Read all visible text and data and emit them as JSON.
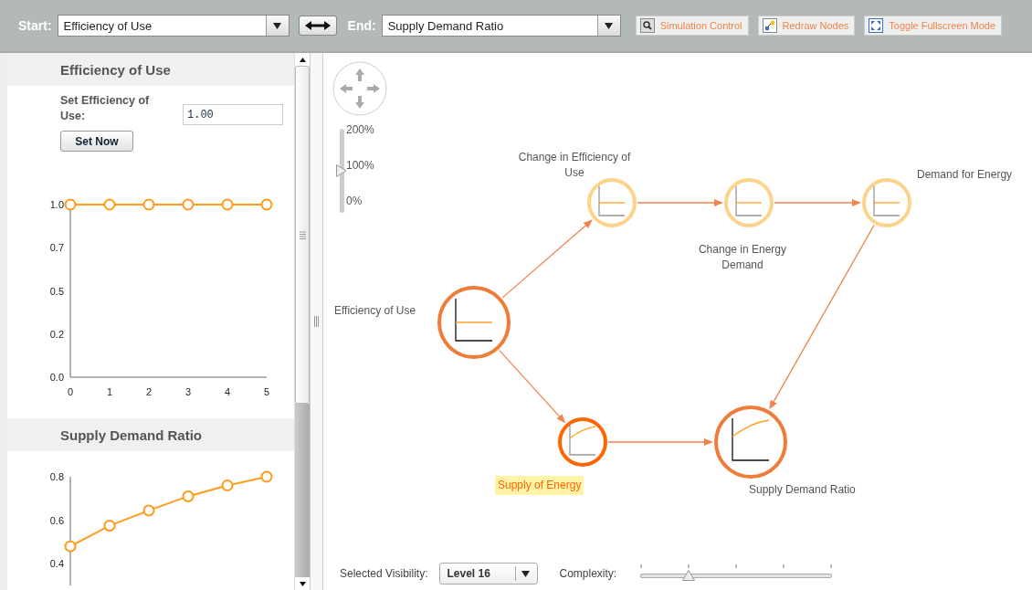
{
  "toolbar": {
    "start_label": "Start:",
    "start_value": "Efficiency of Use",
    "end_label": "End:",
    "end_value": "Supply Demand Ratio",
    "buttons": [
      {
        "label": "Simulation Control",
        "kind": "simulation"
      },
      {
        "label": "Redraw Nodes",
        "kind": "redraw"
      },
      {
        "label": "Toggle Fullscreen Mode",
        "kind": "fullscreen"
      }
    ]
  },
  "sidebar": {
    "sections": [
      {
        "title": "Efficiency of Use",
        "field_label": "Set Efficiency of Use:",
        "field_value": "1.00",
        "button": "Set Now",
        "chart_data": {
          "type": "line",
          "x": [
            0,
            1,
            2,
            3,
            4,
            5
          ],
          "series": [
            {
              "color": "#ff9a1a",
              "marker": "circle",
              "values": [
                1.0,
                1.0,
                1.0,
                1.0,
                1.0,
                1.0
              ]
            }
          ],
          "xlim": [
            0,
            5
          ],
          "ylim": [
            0,
            1
          ],
          "xticks": [
            0,
            1,
            2,
            3,
            4,
            5
          ],
          "yticks": [
            {
              "value": 0,
              "label": "0.0"
            },
            {
              "value": 0.25,
              "label": "0.2"
            },
            0.5,
            {
              "value": 0.75,
              "label": "0.7"
            },
            {
              "value": 1,
              "label": "1.0"
            }
          ]
        }
      },
      {
        "title": "Supply Demand Ratio",
        "chart_data": {
          "type": "line",
          "series": [
            {
              "color": "#ff9a1a",
              "marker": "circle",
              "values": [
                0.48,
                0.575,
                0.645,
                0.71,
                0.76,
                0.8
              ]
            }
          ],
          "ylim": [
            0.3,
            0.8
          ],
          "yticks": [
            0.4,
            0.6,
            0.8
          ]
        }
      }
    ]
  },
  "canvas": {
    "zoom": {
      "ticks": [
        "200%",
        "100%",
        "0%"
      ],
      "level": 0.5
    },
    "nodes": [
      {
        "label": "Efficiency of Use",
        "color": "#ee7d3b",
        "kind": "flat",
        "selected": false
      },
      {
        "label": "Change in Efficiency of Use",
        "color": "#fdd38c",
        "kind": "flat",
        "selected": false
      },
      {
        "label": "Change in Energy Demand",
        "color": "#fdd38c",
        "kind": "flat",
        "selected": false
      },
      {
        "label": "Demand for Energy",
        "color": "#fdd38c",
        "kind": "flat",
        "selected": false
      },
      {
        "label": "Supply of Energy",
        "color": "#ff6600",
        "kind": "rising",
        "selected": true
      },
      {
        "label": "Supply Demand Ratio",
        "color": "#ee7d3b",
        "kind": "rising",
        "selected": false
      }
    ]
  },
  "footer": {
    "visibility_label": "Selected Visibility:",
    "visibility_value": "Level 16",
    "complexity": {
      "label": "Complexity:",
      "level": 0.25
    }
  }
}
